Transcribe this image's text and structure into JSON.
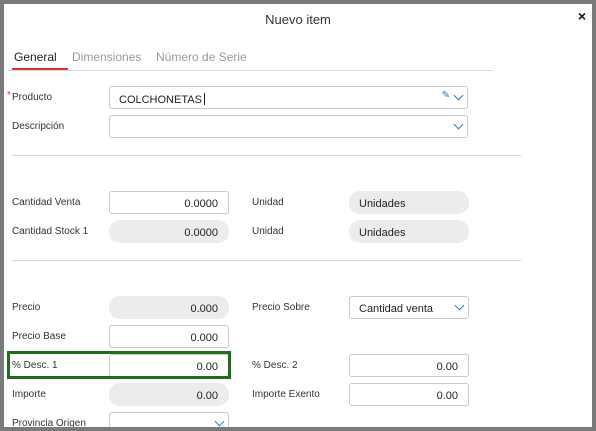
{
  "dialog": {
    "title": "Nuevo item",
    "close_symbol": "×"
  },
  "tabs": [
    {
      "label": "General",
      "active": true
    },
    {
      "label": "Dimensiones",
      "active": false
    },
    {
      "label": "Número de Serie",
      "active": false
    }
  ],
  "fields": {
    "producto": {
      "label": "Producto",
      "value": "COLCHONETAS",
      "required_mark": "*"
    },
    "descripcion": {
      "label": "Descripción",
      "value": ""
    },
    "cantidad_venta": {
      "label": "Cantidad Venta",
      "value": "0.0000"
    },
    "unidad_venta": {
      "label": "Unidad",
      "value": "Unidades"
    },
    "cantidad_stock": {
      "label": "Cantidad Stock 1",
      "value": "0.0000"
    },
    "unidad_stock": {
      "label": "Unidad",
      "value": "Unidades"
    },
    "precio": {
      "label": "Precio",
      "value": "0.000"
    },
    "precio_sobre": {
      "label": "Precio Sobre",
      "value": "Cantidad venta"
    },
    "precio_base": {
      "label": "Precio Base",
      "value": "0.000"
    },
    "desc1": {
      "label": "% Desc. 1",
      "value": "0.00"
    },
    "desc2": {
      "label": "% Desc. 2",
      "value": "0.00"
    },
    "importe": {
      "label": "Importe",
      "value": "0.00"
    },
    "importe_exento": {
      "label": "Importe Exento",
      "value": "0.00"
    },
    "provincia_origen": {
      "label": "Provincia Origen",
      "value": ""
    }
  },
  "colors": {
    "accent": "#d9342b",
    "highlight": "#1e6e1e",
    "link": "#2f79c6"
  }
}
